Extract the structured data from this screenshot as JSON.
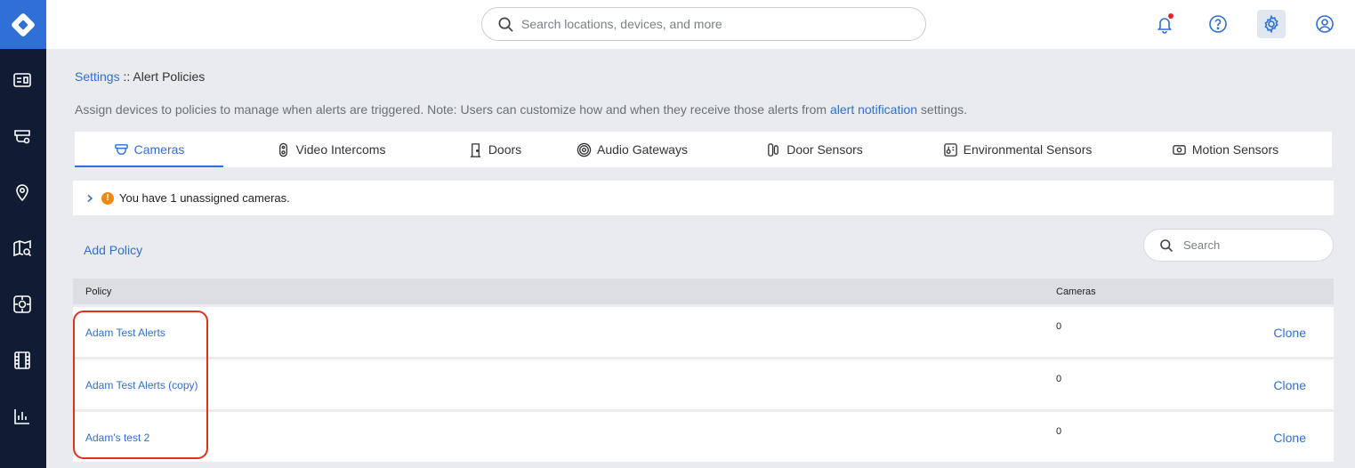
{
  "topbar": {
    "search_placeholder": "Search locations, devices, and more"
  },
  "breadcrumb": {
    "root": "Settings",
    "separator": " :: ",
    "current": "Alert Policies"
  },
  "description": {
    "text": "Assign devices to policies to manage when alerts are triggered. Note: Users can customize how and when they receive those alerts from ",
    "link": "alert notification",
    "suffix": " settings."
  },
  "tabs": [
    {
      "label": "Cameras",
      "icon": "camera-icon",
      "active": true
    },
    {
      "label": "Video Intercoms",
      "icon": "intercom-icon",
      "active": false
    },
    {
      "label": "Doors",
      "icon": "door-icon",
      "active": false
    },
    {
      "label": "Audio Gateways",
      "icon": "audio-gateway-icon",
      "active": false
    },
    {
      "label": "Door Sensors",
      "icon": "door-sensor-icon",
      "active": false
    },
    {
      "label": "Environmental Sensors",
      "icon": "environmental-sensor-icon",
      "active": false
    },
    {
      "label": "Motion Sensors",
      "icon": "motion-sensor-icon",
      "active": false
    }
  ],
  "unassigned": {
    "badge": "!",
    "message": "You have 1 unassigned cameras."
  },
  "actions": {
    "add_policy": "Add Policy",
    "search_placeholder": "Search"
  },
  "table": {
    "columns": [
      "Policy",
      "Cameras"
    ],
    "rows": [
      {
        "policy": "Adam Test Alerts",
        "cameras": "0",
        "action": "Clone"
      },
      {
        "policy": "Adam Test Alerts (copy)",
        "cameras": "0",
        "action": "Clone"
      },
      {
        "policy": "Adam's test 2",
        "cameras": "0",
        "action": "Clone"
      }
    ]
  },
  "colors": {
    "accent": "#2f6fd6",
    "sidebar": "#0f1c33",
    "warning": "#ef8a12",
    "highlight": "#e0301e"
  }
}
